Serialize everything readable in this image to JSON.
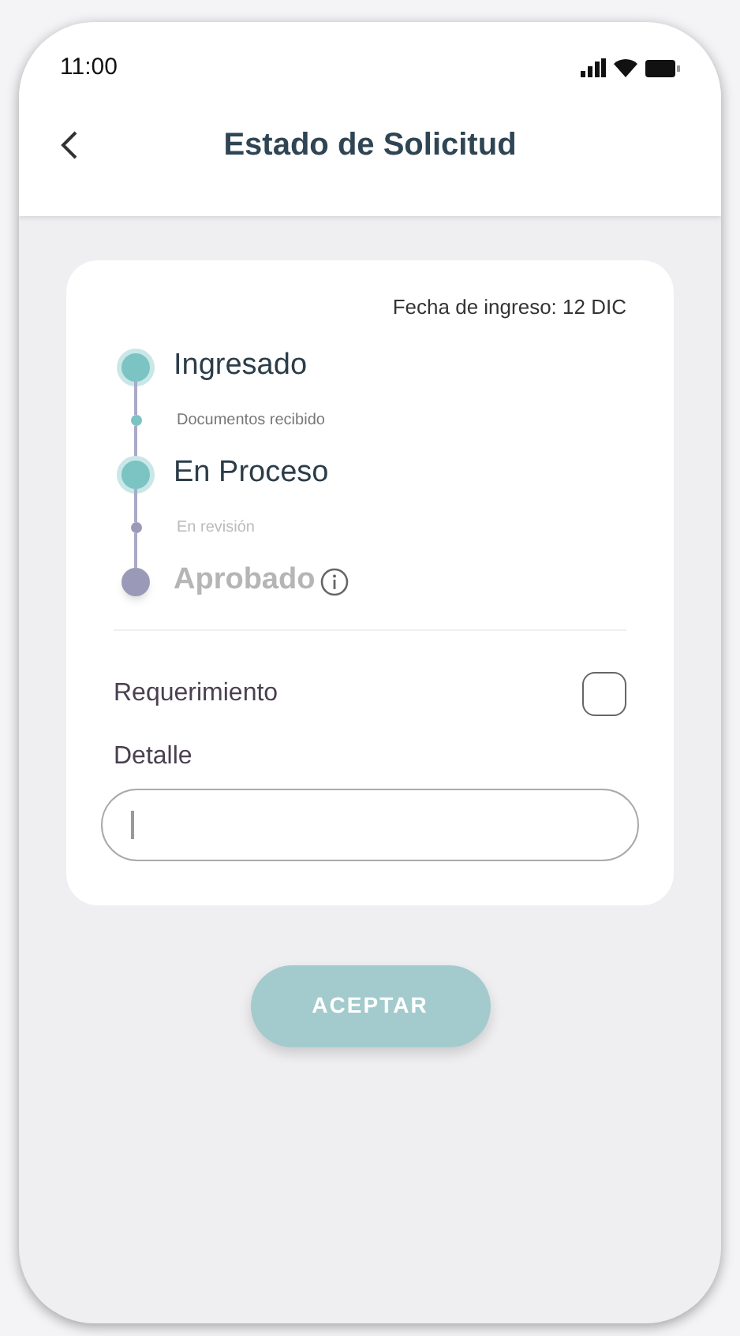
{
  "status_bar": {
    "time": "11:00"
  },
  "header": {
    "title": "Estado de Solicitud"
  },
  "card": {
    "date": "Fecha de ingreso: 12 DIC",
    "timeline": [
      {
        "kind": "main",
        "label": "Ingresado",
        "done": true,
        "info": false
      },
      {
        "kind": "sub",
        "label": "Documentos recibido",
        "done": true
      },
      {
        "kind": "main",
        "label": "En Proceso",
        "done": true,
        "info": false
      },
      {
        "kind": "sub",
        "label": "En revisión",
        "done": false
      },
      {
        "kind": "main",
        "label": "Aprobado",
        "done": false,
        "info": true
      }
    ],
    "requirement": {
      "label": "Requerimiento",
      "checked": false
    },
    "detail": {
      "label": "Detalle",
      "focused": true
    }
  },
  "button": {
    "label": "ACEPTAR"
  }
}
